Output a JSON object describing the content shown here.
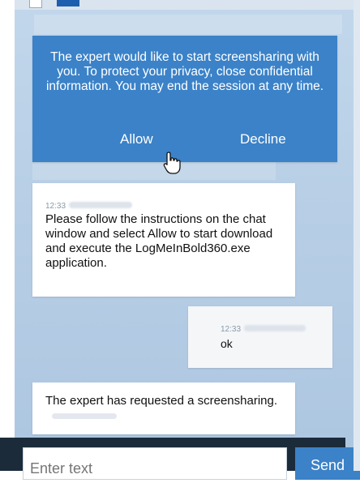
{
  "dialog": {
    "message": "The expert would like to start screensharing with you. To protect your privacy, close confidential information. You may end the session at any time.",
    "allow_label": "Allow",
    "decline_label": "Decline"
  },
  "messages": [
    {
      "time": "12:33",
      "text": "Please follow the instructions on the chat window and select Allow to start download and execute the LogMeInBold360.exe application."
    },
    {
      "time": "12:33",
      "text": "ok"
    },
    {
      "text": "The expert has requested a screensharing."
    }
  ],
  "composer": {
    "placeholder": "Enter text",
    "send_label": "Send"
  },
  "colors": {
    "accent": "#3b82c8",
    "background": "#b8cfe6",
    "bubble": "#ffffff"
  },
  "icons": {
    "cursor": "hand-pointer-icon"
  }
}
